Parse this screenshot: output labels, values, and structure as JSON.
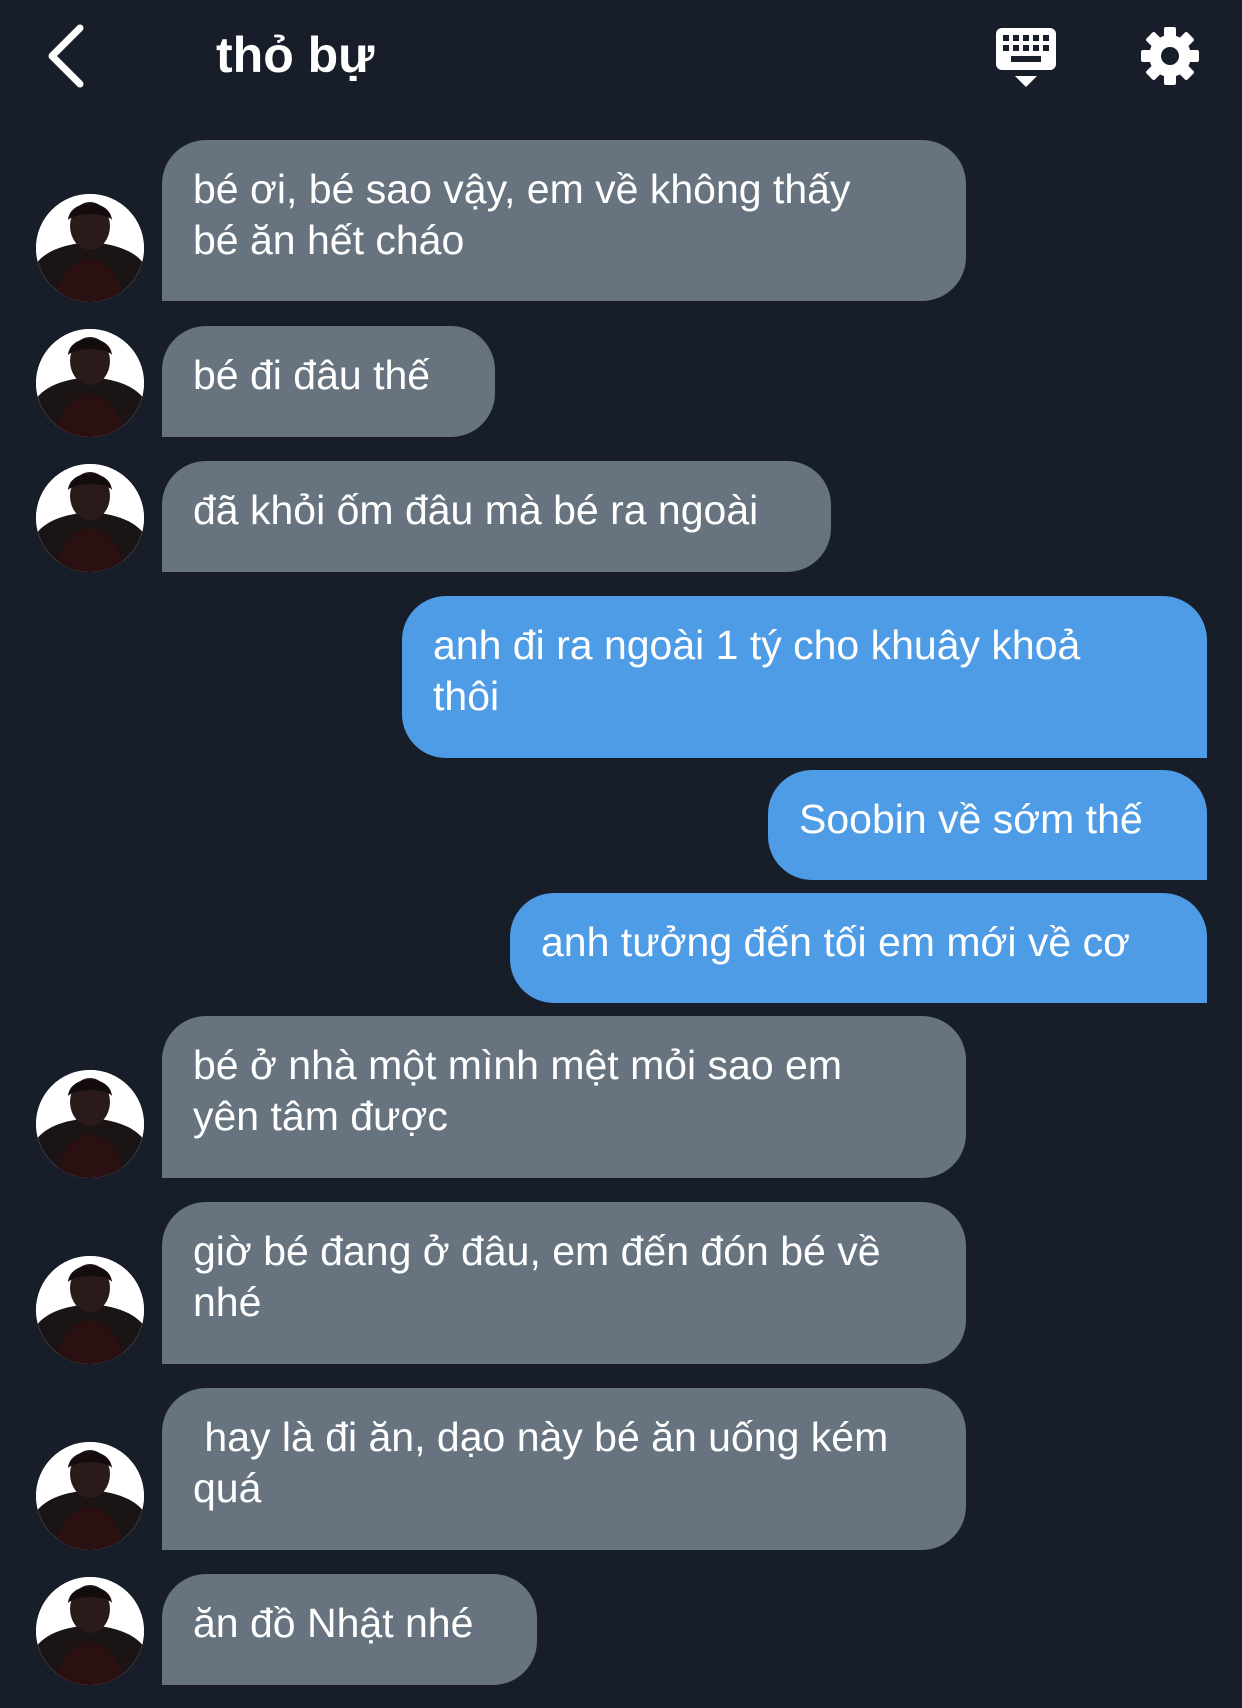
{
  "header": {
    "title": "thỏ bự"
  },
  "icons": {
    "back": "chevron-left-icon",
    "keyboard": "keyboard-icon",
    "settings": "gear-icon"
  },
  "colors": {
    "background": "#171e2a",
    "incoming_bubble": "#67737f",
    "outgoing_bubble": "#4e9be6",
    "text": "#ffffff"
  },
  "messages": [
    {
      "direction": "incoming",
      "text": "bé ơi, bé sao vậy, em về không thấy\nbé ăn hết cháo"
    },
    {
      "direction": "incoming",
      "text": "bé đi đâu thế"
    },
    {
      "direction": "incoming",
      "text": "đã khỏi ốm đâu mà bé ra ngoài"
    },
    {
      "direction": "outgoing",
      "text": "anh đi ra ngoài 1 tý cho khuây khoả\nthôi"
    },
    {
      "direction": "outgoing",
      "text": "Soobin về sớm thế"
    },
    {
      "direction": "outgoing",
      "text": "anh tưởng đến tối em mới về cơ"
    },
    {
      "direction": "incoming",
      "text": "bé ở nhà một mình mệt mỏi sao em\nyên tâm được"
    },
    {
      "direction": "incoming",
      "text": "giờ bé đang ở đâu, em đến đón bé về\nnhé"
    },
    {
      "direction": "incoming",
      "text": " hay là đi ăn, dạo này bé ăn uống kém\nquá"
    },
    {
      "direction": "incoming",
      "text": "ăn đồ Nhật nhé"
    }
  ]
}
